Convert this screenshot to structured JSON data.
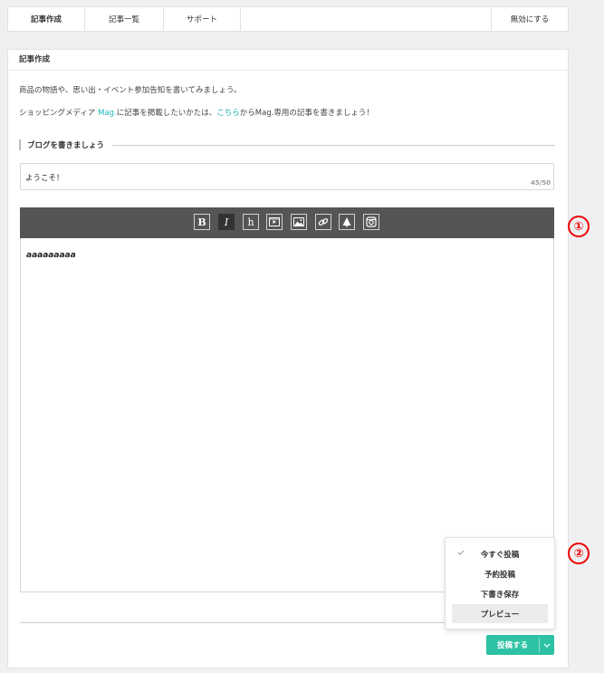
{
  "tabs": {
    "items": [
      {
        "label": "記事作成"
      },
      {
        "label": "記事一覧"
      },
      {
        "label": "サポート"
      }
    ],
    "disable_label": "無効にする"
  },
  "card": {
    "header": "記事作成",
    "intro_line1": "商品の物語や、思い出・イベント参加告知を書いてみましょう。",
    "intro_line2_a": "ショッピングメディア ",
    "intro_line2_mag": "Mag.",
    "intro_line2_b": "に記事を掲載したいかたは、",
    "intro_line2_link": "こちら",
    "intro_line2_c": "からMag.専用の記事を書きましょう！",
    "section_title": "ブログを書きましょう",
    "title_value": "ようこそ！",
    "title_counter": "45/50",
    "editor_text": "aaaaaaaaa"
  },
  "toolbar": {
    "bold": "B",
    "italic": "I",
    "heading": "h",
    "icons": [
      "bold-icon",
      "italic-icon",
      "heading-icon",
      "video-icon",
      "image-icon",
      "link-icon",
      "tree-icon",
      "instagram-icon"
    ]
  },
  "publish": {
    "button_label": "投稿する",
    "caret": "⌄",
    "menu": [
      {
        "label": "今すぐ投稿",
        "checked": true
      },
      {
        "label": "予約投稿"
      },
      {
        "label": "下書き保存"
      },
      {
        "label": "プレビュー",
        "highlighted": true
      }
    ]
  },
  "annotations": {
    "one": "①",
    "two": "②"
  },
  "colors": {
    "accent": "#2cc2a3",
    "link": "#1fb3b3",
    "toolbar": "#555555",
    "badge": "#ee0000"
  }
}
